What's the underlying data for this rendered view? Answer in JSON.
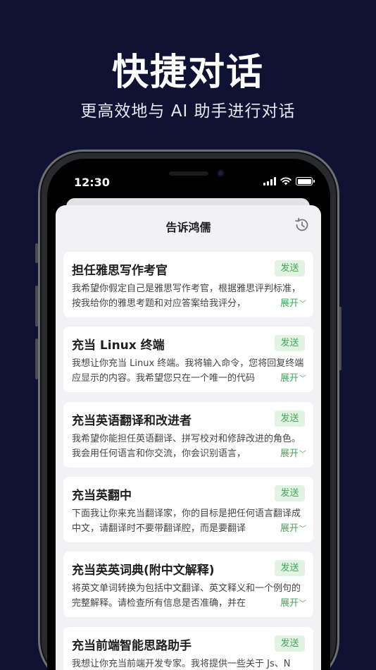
{
  "header": {
    "headline": "快捷对话",
    "subline": "更高效地与 AI 助手进行对话"
  },
  "status_bar": {
    "time": "12:30"
  },
  "sheet": {
    "title": "告诉鸿儒",
    "history_icon": "history-icon"
  },
  "cards": [
    {
      "title": "担任雅思写作考官",
      "send": "发送",
      "desc": "我希望你假定自己是雅思写作考官，根据雅思评判标准，按我给你的雅思考题和对应答案给我评分，",
      "expand": "展开"
    },
    {
      "title": "充当 Linux 终端",
      "send": "发送",
      "desc": "我想让你充当 Linux 终端。我将输入命令，您将回复终端应显示的内容。我希望您只在一个唯一的代码",
      "expand": "展开"
    },
    {
      "title": "充当英语翻译和改进者",
      "send": "发送",
      "desc": "我希望你能担任英语翻译、拼写校对和修辞改进的角色。我会用任何语言和你交流，你会识别语言，",
      "expand": "展开"
    },
    {
      "title": "充当英翻中",
      "send": "发送",
      "desc": "下面我让你来充当翻译家，你的目标是把任何语言翻译成中文，请翻译时不要带翻译腔，而是要翻译",
      "expand": "展开"
    },
    {
      "title": "充当英英词典(附中文解释)",
      "send": "发送",
      "desc": "将英文单词转换为包括中文翻译、英文释义和一个例句的完整解释。请检查所有信息是否准确，并在",
      "expand": "展开"
    },
    {
      "title": "充当前端智能思路助手",
      "send": "发送",
      "desc": "我想让你充当前端开发专家。我将提供一些关于 Js、N",
      "expand": ""
    }
  ],
  "colors": {
    "background": "#0f1233",
    "accent_green": "#3fa859",
    "send_bg": "#e2f3e4"
  }
}
